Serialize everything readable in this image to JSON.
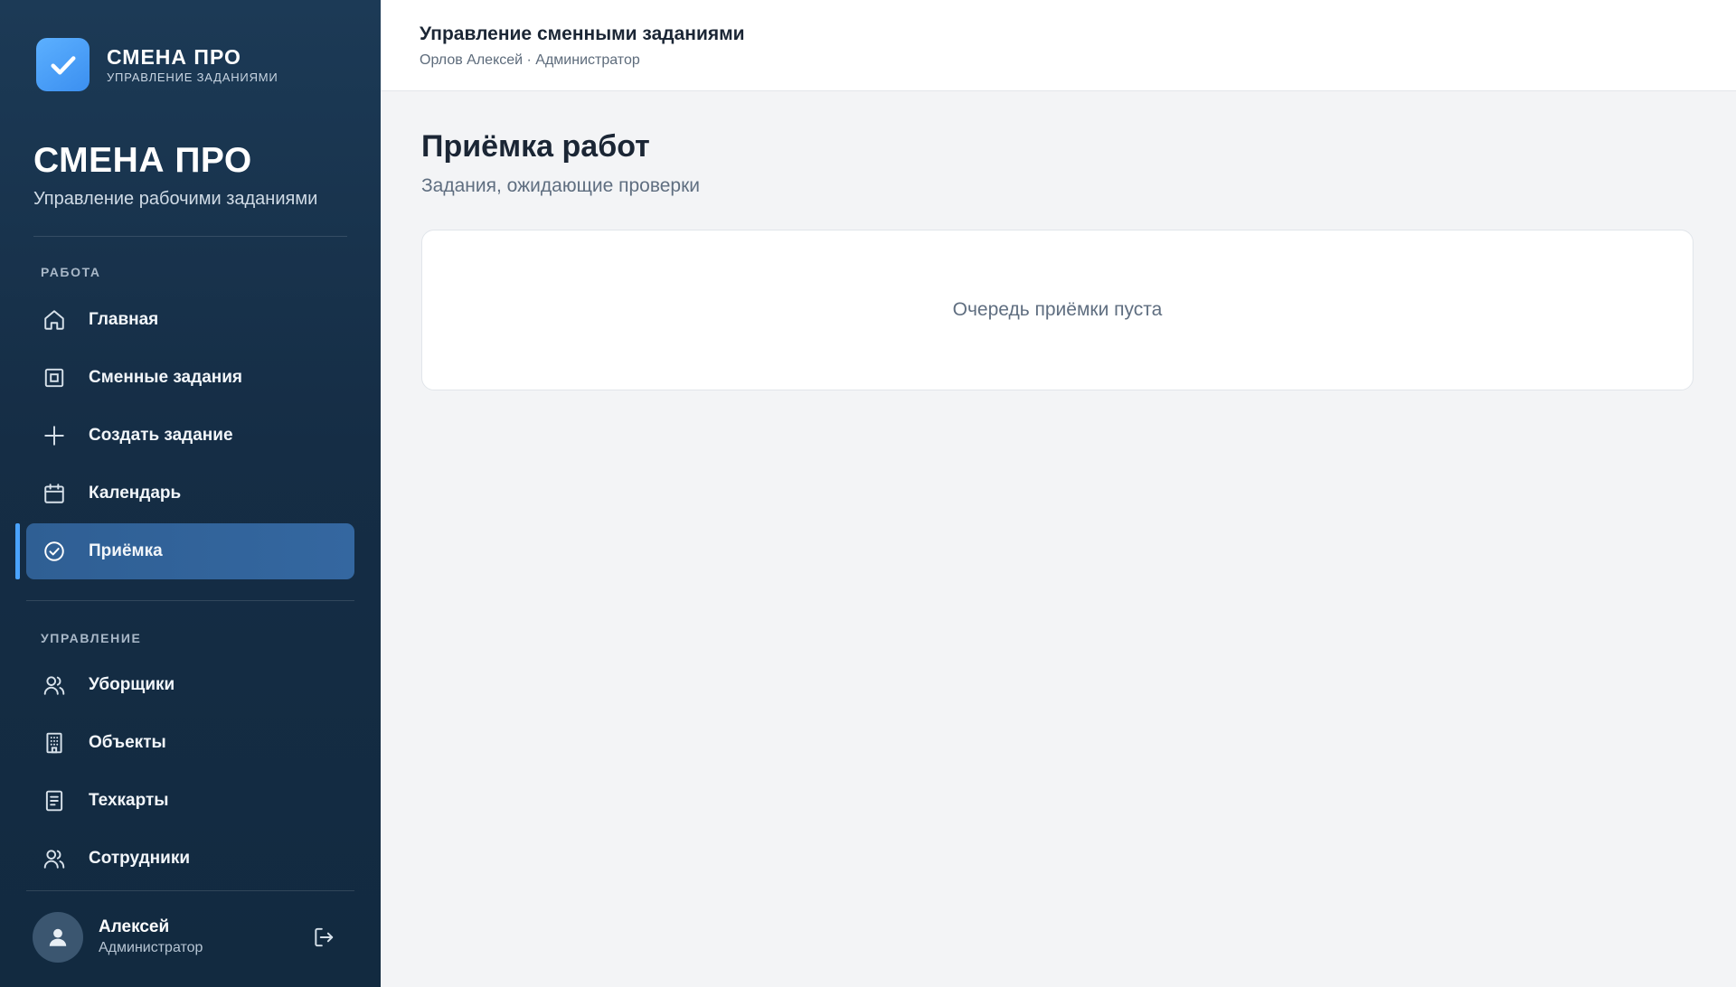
{
  "brand": {
    "name": "СМЕНА ПРО",
    "tagline": "УПРАВЛЕНИЕ ЗАДАНИЯМИ",
    "logo_icon": "checkmark-icon",
    "logo_color": "#4a9ff5"
  },
  "sidebar": {
    "title": "СМЕНА ПРО",
    "subtitle": "Управление рабочими заданиями",
    "sections": [
      {
        "label": "РАБОТА",
        "items": [
          {
            "label": "Главная",
            "icon": "home-icon"
          },
          {
            "label": "Сменные задания",
            "icon": "square-icon"
          },
          {
            "label": "Создать задание",
            "icon": "plus-icon"
          },
          {
            "label": "Календарь",
            "icon": "calendar-icon"
          },
          {
            "label": "Приёмка",
            "icon": "check-circle-icon",
            "active": true
          }
        ]
      },
      {
        "label": "УПРАВЛЕНИЕ",
        "items": [
          {
            "label": "Уборщики",
            "icon": "users-icon"
          },
          {
            "label": "Объекты",
            "icon": "building-icon"
          },
          {
            "label": "Техкарты",
            "icon": "document-icon"
          },
          {
            "label": "Сотрудники",
            "icon": "users-icon"
          }
        ]
      }
    ],
    "user": {
      "name": "Алексей",
      "role": "Администратор",
      "avatar_icon": "person-icon",
      "logout_icon": "logout-icon"
    },
    "accent_color": "#4aa3ff"
  },
  "header": {
    "title": "Управление сменными заданиями",
    "subtitle": "Орлов Алексей · Администратор"
  },
  "main": {
    "title": "Приёмка работ",
    "subtitle": "Задания, ожидающие проверки",
    "empty_message": "Очередь приёмки пуста"
  }
}
